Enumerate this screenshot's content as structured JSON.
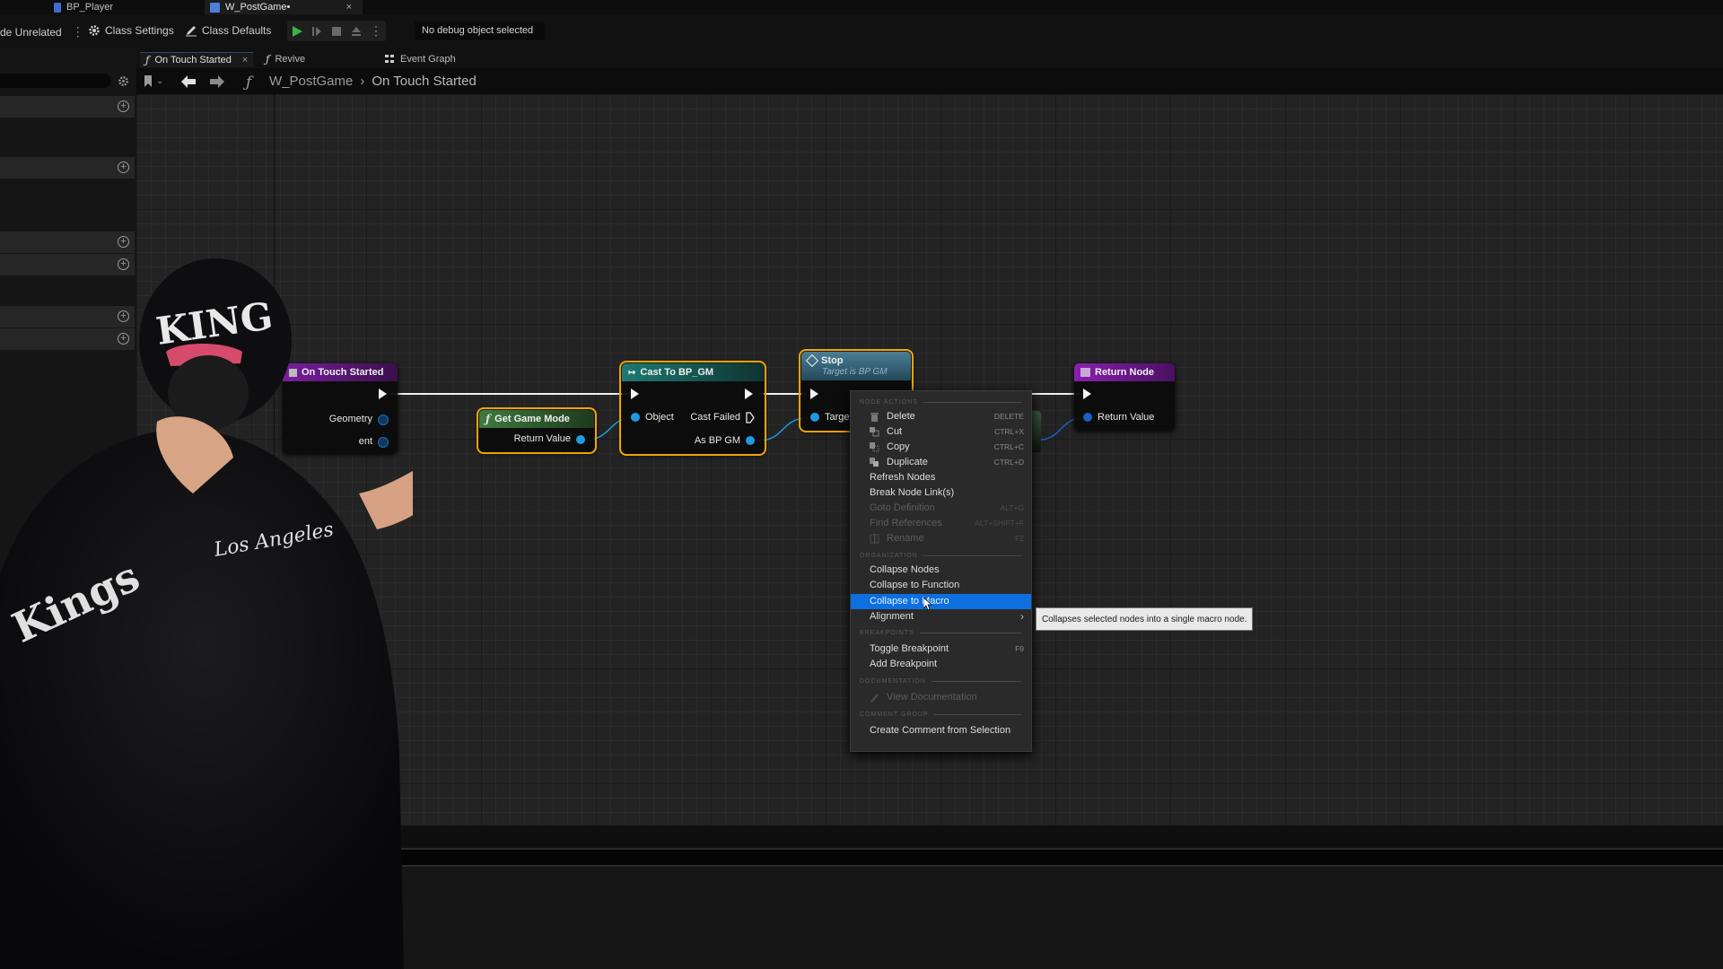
{
  "doc_tabs": [
    {
      "label": "BP_Player",
      "icon": "blueprint-actor-icon",
      "active": false
    },
    {
      "label": "W_PostGame•",
      "icon": "widget-blueprint-icon",
      "active": true,
      "close": "×"
    }
  ],
  "toolbar": {
    "hide_unrelated": "de Unrelated",
    "more": "⋮",
    "class_settings": "Class Settings",
    "class_defaults": "Class Defaults",
    "debug_select": "No debug object selected",
    "play_buttons": [
      "play",
      "step",
      "stop",
      "eject",
      "more"
    ]
  },
  "graph_tabs": [
    {
      "label": "On Touch Started",
      "icon": "function-icon",
      "active": true,
      "close": "×"
    },
    {
      "label": "Revive",
      "icon": "function-icon",
      "active": false
    },
    {
      "label": "Event Graph",
      "icon": "event-graph-icon",
      "active": false
    }
  ],
  "breadcrumb": {
    "root": "W_PostGame",
    "separator": "›",
    "current": "On Touch Started"
  },
  "nodes": {
    "entry": {
      "title": "On Touch Started",
      "pins": [
        "Geometry",
        "ent"
      ],
      "header_color": "#7a1e9e"
    },
    "get_game_mode": {
      "title": "Get Game Mode",
      "pins": [
        "Return Value"
      ],
      "header_color": "#3a6b3a"
    },
    "cast": {
      "title": "Cast To BP_GM",
      "pins_in": [
        "Object"
      ],
      "pins_out": [
        "Cast Failed",
        "As BP GM"
      ],
      "header_color": "#1a6b66"
    },
    "stop": {
      "title": "Stop",
      "subtitle": "Target is BP GM",
      "pins": [
        "Target"
      ],
      "header_color": "#3a6a80"
    },
    "return": {
      "title": "Return Node",
      "pins": [
        "Return Value"
      ],
      "header_color": "#7a1e9e"
    }
  },
  "context_menu": {
    "sections": {
      "node_actions": "NODE ACTIONS",
      "organization": "ORGANIZATION",
      "breakpoints": "BREAKPOINTS",
      "documentation": "DOCUMENTATION",
      "comment_group": "COMMENT GROUP"
    },
    "items": [
      {
        "label": "Delete",
        "shortcut": "DELETE",
        "icon": "trash-icon",
        "enabled": true
      },
      {
        "label": "Cut",
        "shortcut": "CTRL+X",
        "icon": "cut-icon",
        "enabled": true
      },
      {
        "label": "Copy",
        "shortcut": "CTRL+C",
        "icon": "copy-icon",
        "enabled": true
      },
      {
        "label": "Duplicate",
        "shortcut": "CTRL+D",
        "icon": "duplicate-icon",
        "enabled": true
      },
      {
        "label": "Refresh Nodes",
        "shortcut": "",
        "enabled": true
      },
      {
        "label": "Break Node Link(s)",
        "shortcut": "",
        "enabled": true
      },
      {
        "label": "Goto Definition",
        "shortcut": "ALT+G",
        "enabled": false
      },
      {
        "label": "Find References",
        "shortcut": "ALT+SHIFT+F",
        "enabled": false
      },
      {
        "label": "Rename",
        "shortcut": "F2",
        "icon": "rename-icon",
        "enabled": false
      },
      {
        "label": "Collapse Nodes",
        "shortcut": "",
        "enabled": true
      },
      {
        "label": "Collapse to Function",
        "shortcut": "",
        "enabled": true
      },
      {
        "label": "Collapse to Macro",
        "shortcut": "",
        "enabled": true,
        "highlighted": true
      },
      {
        "label": "Alignment",
        "shortcut": "›",
        "enabled": true,
        "submenu": true
      },
      {
        "label": "Toggle Breakpoint",
        "shortcut": "F9",
        "enabled": true
      },
      {
        "label": "Add Breakpoint",
        "shortcut": "",
        "enabled": true
      },
      {
        "label": "View Documentation",
        "shortcut": "",
        "icon": "documentation-icon",
        "enabled": false
      },
      {
        "label": "Create Comment from Selection",
        "shortcut": "",
        "enabled": true
      }
    ]
  },
  "tooltip": "Collapses selected nodes into a single macro node.",
  "colors": {
    "selection_outline": "#f2a300",
    "menu_highlight": "#0d6fe0",
    "pin_object": "#1e9be0"
  }
}
